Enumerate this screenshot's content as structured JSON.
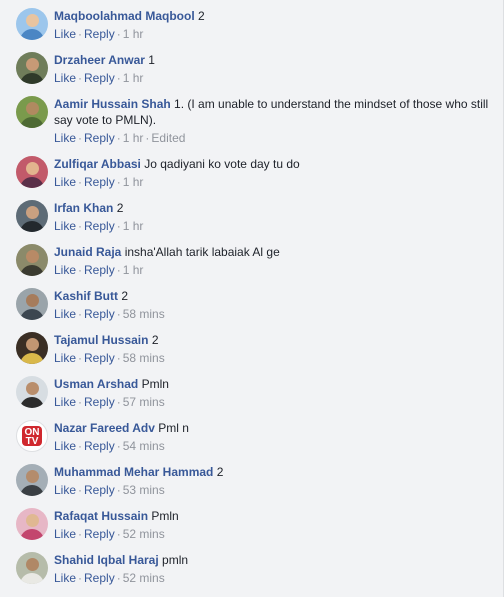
{
  "actions": {
    "like": "Like",
    "reply": "Reply",
    "separator": "·",
    "edited": "Edited"
  },
  "comments": [
    {
      "name": "Maqboolahmad Maqbool",
      "text": "2",
      "time": "1 hr"
    },
    {
      "name": "Drzaheer Anwar",
      "text": "1",
      "time": "1 hr"
    },
    {
      "name": "Aamir Hussain Shah",
      "text": "1. (I am unable to understand the mindset of those who still say vote to PMLN).",
      "time": "1 hr"
    },
    {
      "name": "Zulfiqar Abbasi",
      "text": "Jo qadiyani ko vote day tu do",
      "time": "1 hr"
    },
    {
      "name": "Irfan Khan",
      "text": "2",
      "time": "1 hr"
    },
    {
      "name": "Junaid Raja",
      "text": "insha'Allah tarik labaiak Al ge",
      "time": "1 hr"
    },
    {
      "name": "Kashif Butt",
      "text": "2",
      "time": "58 mins"
    },
    {
      "name": "Tajamul Hussain",
      "text": "2",
      "time": "58 mins"
    },
    {
      "name": "Usman Arshad",
      "text": "Pmln",
      "time": "57 mins"
    },
    {
      "name": "Nazar Fareed Adv",
      "text": "Pml n",
      "time": "54 mins",
      "avatar_logo": "ON TV"
    },
    {
      "name": "Muhammad Mehar Hammad",
      "text": "2",
      "time": "53 mins"
    },
    {
      "name": "Rafaqat Hussain",
      "text": "Pmln",
      "time": "52 mins"
    },
    {
      "name": "Shahid Iqbal Haraj",
      "text": "pmln",
      "time": "52 mins"
    }
  ],
  "colors": {
    "name_link": "#385898",
    "meta": "#90949c",
    "background": "#f2f3f5"
  }
}
